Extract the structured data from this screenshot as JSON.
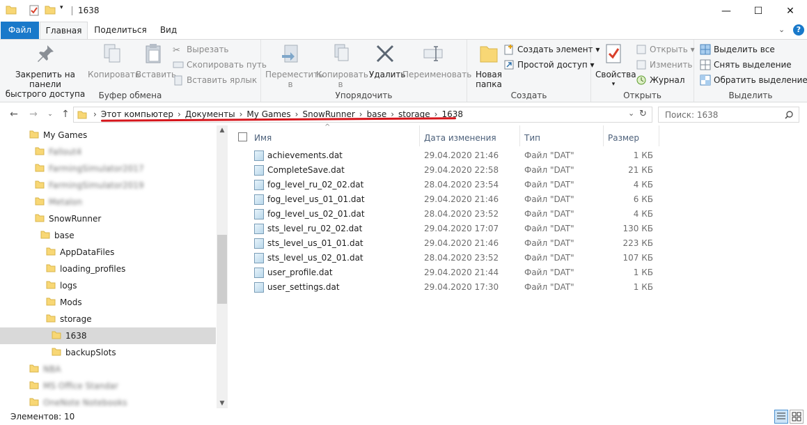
{
  "window": {
    "title": "1638",
    "minimize": "—",
    "maximize": "☐",
    "close": "✕"
  },
  "tabs": [
    "Файл",
    "Главная",
    "Поделиться",
    "Вид"
  ],
  "ribbon": {
    "clipboard": {
      "label": "Буфер обмена",
      "pin_line1": "Закрепить на панели",
      "pin_line2": "быстрого доступа",
      "copy": "Копировать",
      "paste": "Вставить",
      "cut": "Вырезать",
      "copy_path": "Скопировать путь",
      "paste_shortcut": "Вставить ярлык"
    },
    "organize": {
      "label": "Упорядочить",
      "move_line1": "Переместить",
      "move_line2": "в",
      "copyto_line1": "Копировать",
      "copyto_line2": "в",
      "delete": "Удалить",
      "rename": "Переименовать"
    },
    "create": {
      "label": "Создать",
      "new_folder_line1": "Новая",
      "new_folder_line2": "папка",
      "new_item": "Создать элемент",
      "easy_access": "Простой доступ"
    },
    "open": {
      "label": "Открыть",
      "properties": "Свойства",
      "open": "Открыть",
      "edit": "Изменить",
      "history": "Журнал"
    },
    "select": {
      "label": "Выделить",
      "select_all": "Выделить все",
      "select_none": "Снять выделение",
      "invert": "Обратить выделение"
    }
  },
  "address": {
    "crumbs": [
      "Этот компьютер",
      "Документы",
      "My Games",
      "SnowRunner",
      "base",
      "storage",
      "1638"
    ],
    "search_placeholder": "Поиск: 1638"
  },
  "tree": [
    {
      "label": "My Games",
      "blur": false
    },
    {
      "label": "Fallout4",
      "blur": true
    },
    {
      "label": "FarmingSimulator2017",
      "blur": true
    },
    {
      "label": "FarmingSimulator2019",
      "blur": true
    },
    {
      "label": "Metalon",
      "blur": true
    },
    {
      "label": "SnowRunner",
      "blur": false
    },
    {
      "label": "base",
      "blur": false
    },
    {
      "label": "AppDataFiles",
      "blur": false
    },
    {
      "label": "loading_profiles",
      "blur": false
    },
    {
      "label": "logs",
      "blur": false
    },
    {
      "label": "Mods",
      "blur": false
    },
    {
      "label": "storage",
      "blur": false
    },
    {
      "label": "1638",
      "blur": false
    },
    {
      "label": "backupSlots",
      "blur": false
    },
    {
      "label": "NBA",
      "blur": true
    },
    {
      "label": "MS Office Standar",
      "blur": true
    },
    {
      "label": "OneNote Notebooks",
      "blur": true
    }
  ],
  "columns": {
    "name": "Имя",
    "date": "Дата изменения",
    "type": "Тип",
    "size": "Размер"
  },
  "files": [
    {
      "name": "achievements.dat",
      "date": "29.04.2020 21:46",
      "type": "Файл \"DAT\"",
      "size": "1 КБ"
    },
    {
      "name": "CompleteSave.dat",
      "date": "29.04.2020 22:58",
      "type": "Файл \"DAT\"",
      "size": "21 КБ"
    },
    {
      "name": "fog_level_ru_02_02.dat",
      "date": "28.04.2020 23:54",
      "type": "Файл \"DAT\"",
      "size": "4 КБ"
    },
    {
      "name": "fog_level_us_01_01.dat",
      "date": "29.04.2020 21:46",
      "type": "Файл \"DAT\"",
      "size": "6 КБ"
    },
    {
      "name": "fog_level_us_02_01.dat",
      "date": "28.04.2020 23:52",
      "type": "Файл \"DAT\"",
      "size": "4 КБ"
    },
    {
      "name": "sts_level_ru_02_02.dat",
      "date": "29.04.2020 17:07",
      "type": "Файл \"DAT\"",
      "size": "130 КБ"
    },
    {
      "name": "sts_level_us_01_01.dat",
      "date": "29.04.2020 21:46",
      "type": "Файл \"DAT\"",
      "size": "223 КБ"
    },
    {
      "name": "sts_level_us_02_01.dat",
      "date": "28.04.2020 23:52",
      "type": "Файл \"DAT\"",
      "size": "107 КБ"
    },
    {
      "name": "user_profile.dat",
      "date": "29.04.2020 21:44",
      "type": "Файл \"DAT\"",
      "size": "1 КБ"
    },
    {
      "name": "user_settings.dat",
      "date": "29.04.2020 17:30",
      "type": "Файл \"DAT\"",
      "size": "1 КБ"
    }
  ],
  "status": {
    "items": "Элементов: 10"
  },
  "colors": {
    "accent": "#1979ca",
    "underline": "#d6161c",
    "folder": "#f8d775"
  }
}
